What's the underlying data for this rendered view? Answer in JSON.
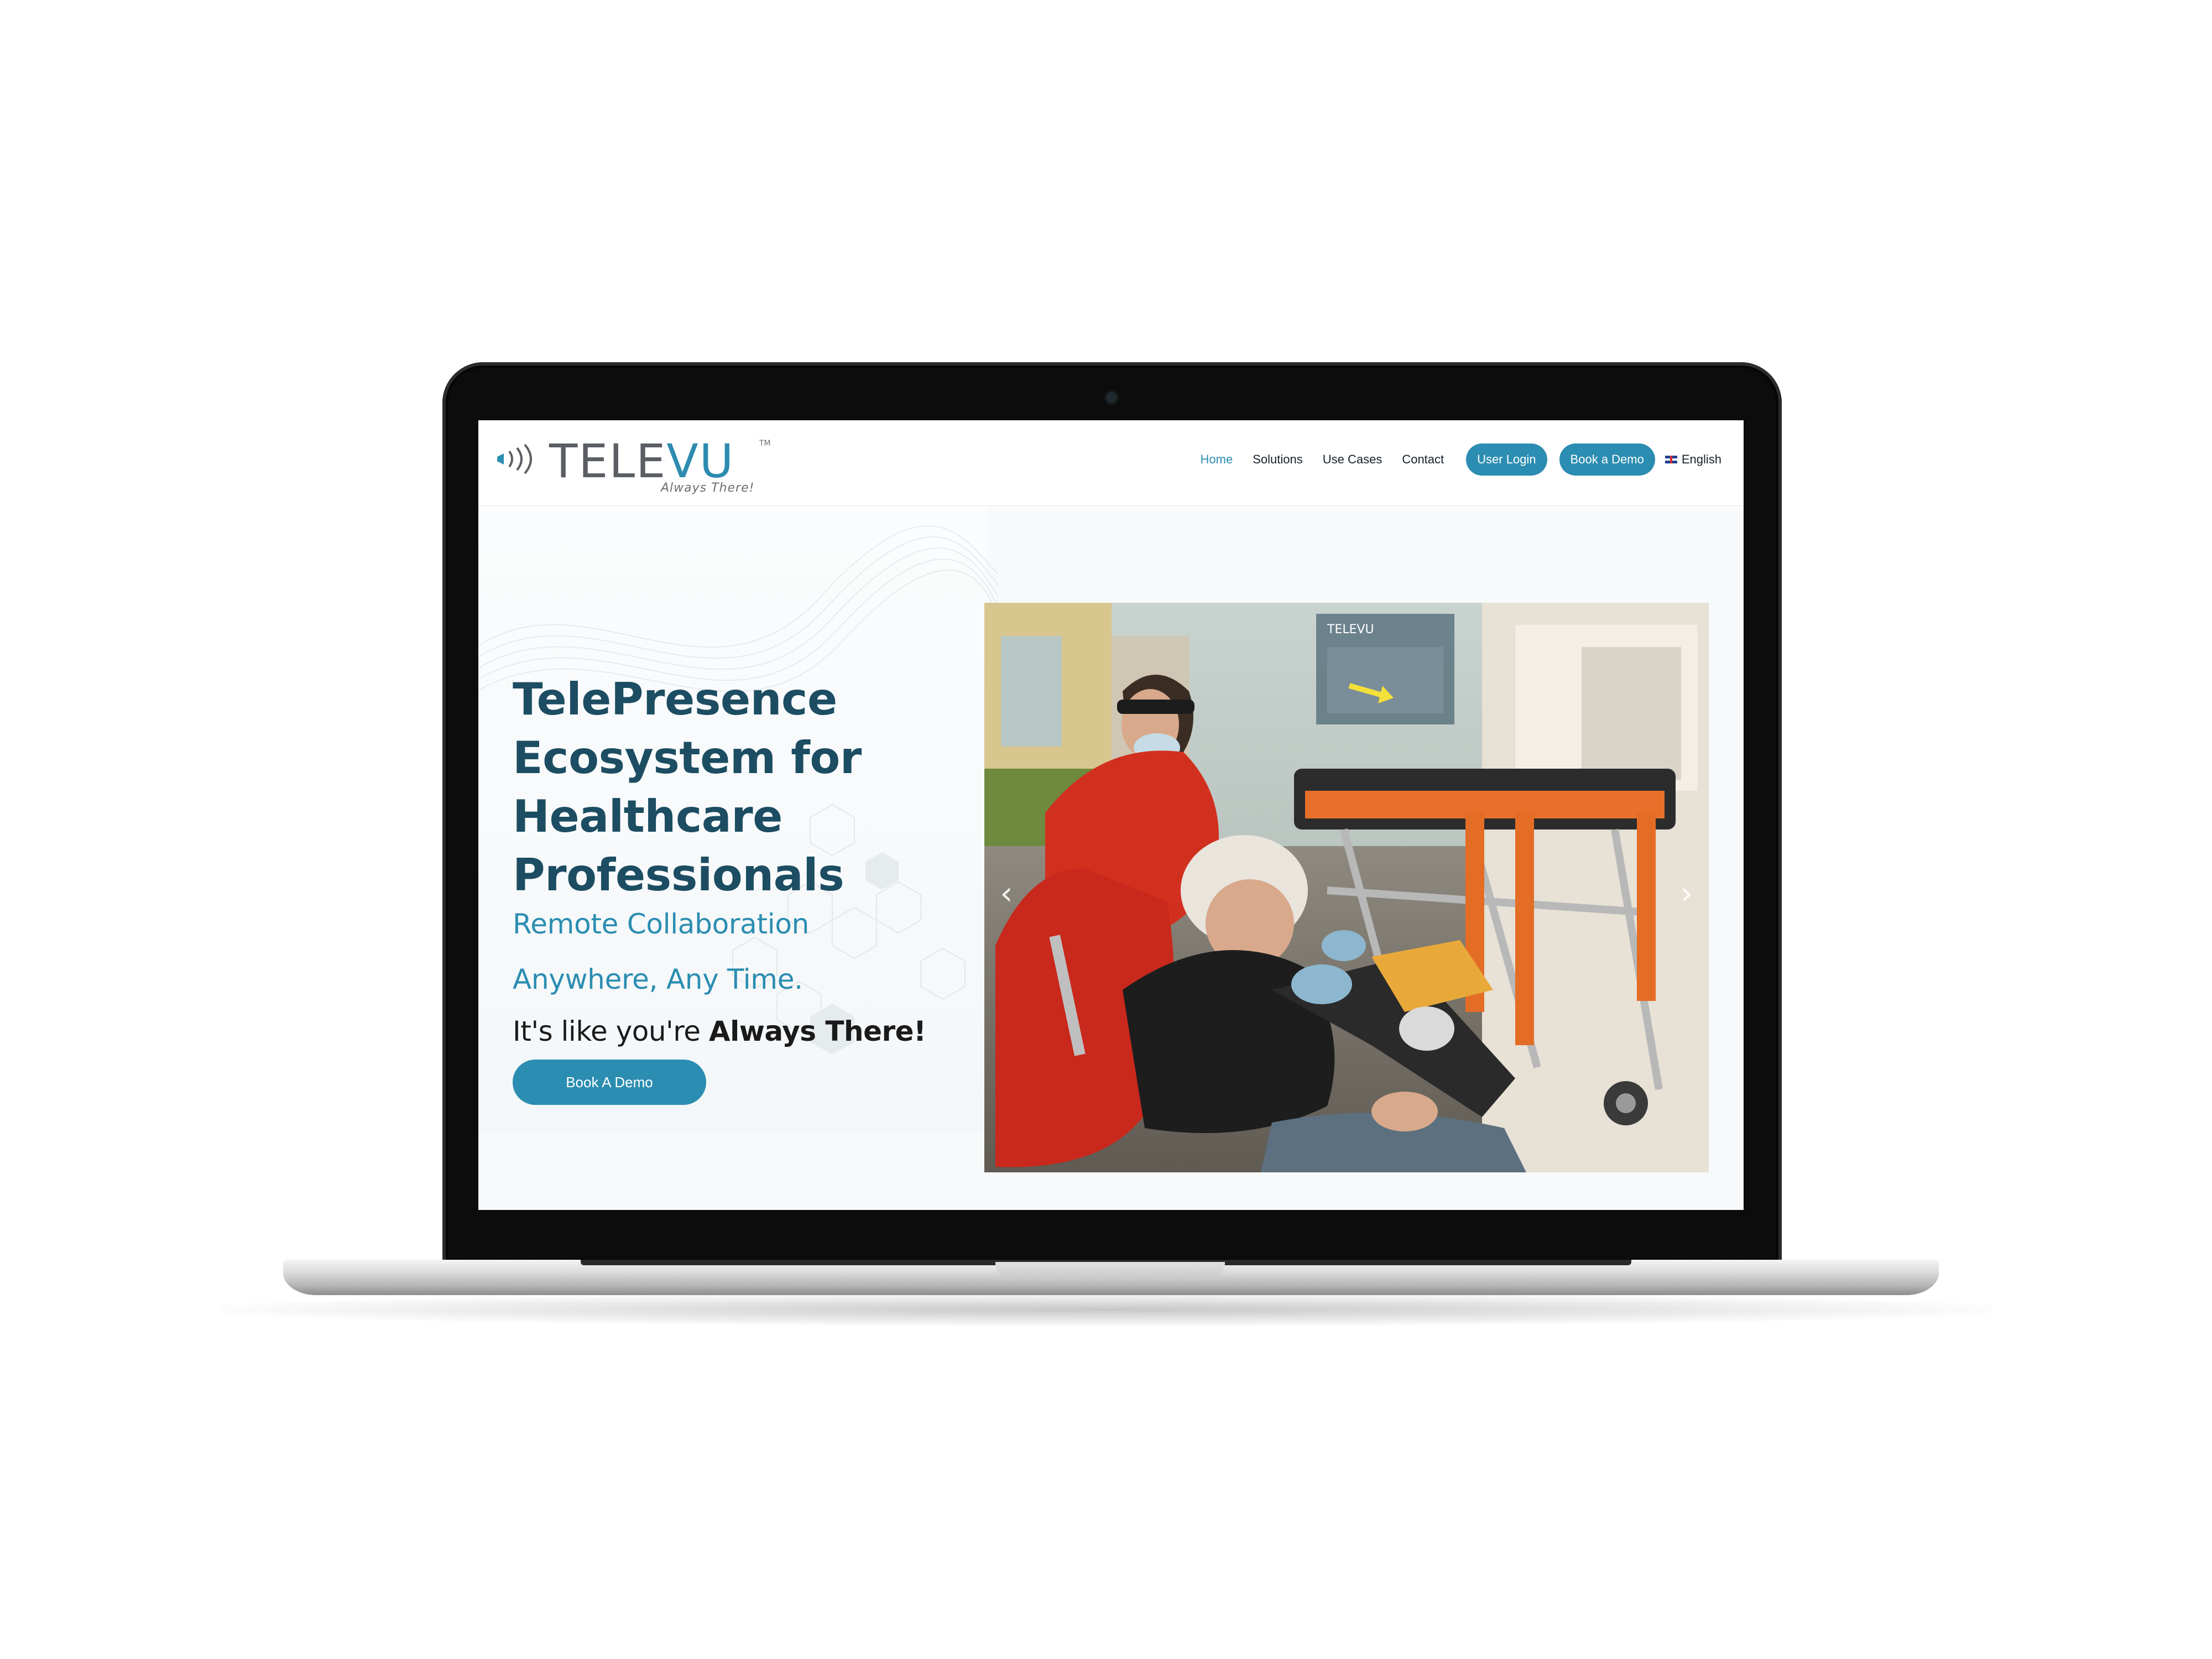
{
  "brand": {
    "name_prefix": "TELE",
    "name_suffix": "VU",
    "trademark": "TM",
    "tagline": "Always There!",
    "primary_color": "#2b8db1",
    "heading_color": "#1c4d62"
  },
  "nav": {
    "links": [
      "Home",
      "Solutions",
      "Use Cases",
      "Contact"
    ],
    "active": "Home",
    "login_label": "User Login",
    "demo_label": "Book a Demo",
    "language": "English"
  },
  "hero": {
    "headline_lines": [
      "TelePresence",
      "Ecosystem for",
      "Healthcare",
      "Professionals"
    ],
    "subhead_1": "Remote Collaboration",
    "subhead_2": "Anywhere, Any Time.",
    "tagline_prefix": "It's like you're ",
    "tagline_bold": "Always There!",
    "cta_label": "Book A Demo"
  },
  "slider": {
    "overlay_brand": "TELEVU",
    "prev_icon": "chevron-left-icon",
    "next_icon": "chevron-right-icon"
  }
}
